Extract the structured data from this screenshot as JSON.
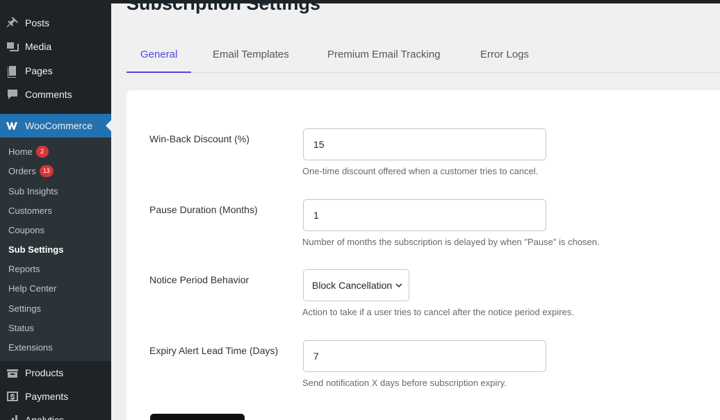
{
  "sidebar": {
    "top_items": [
      {
        "label": "Posts",
        "icon": "pin-icon"
      },
      {
        "label": "Media",
        "icon": "media-icon"
      },
      {
        "label": "Pages",
        "icon": "pages-icon"
      },
      {
        "label": "Comments",
        "icon": "comment-icon"
      }
    ],
    "woocommerce": {
      "label": "WooCommerce",
      "icon": "woo-icon"
    },
    "submenu": [
      {
        "label": "Home",
        "badge": "2"
      },
      {
        "label": "Orders",
        "badge": "13"
      },
      {
        "label": "Sub Insights"
      },
      {
        "label": "Customers"
      },
      {
        "label": "Coupons"
      },
      {
        "label": "Sub Settings",
        "active": true
      },
      {
        "label": "Reports"
      },
      {
        "label": "Help Center"
      },
      {
        "label": "Settings"
      },
      {
        "label": "Status"
      },
      {
        "label": "Extensions"
      }
    ],
    "bottom_items": [
      {
        "label": "Products",
        "icon": "products-icon"
      },
      {
        "label": "Payments",
        "icon": "payments-icon"
      },
      {
        "label": "Analytics",
        "icon": "analytics-icon"
      }
    ]
  },
  "page": {
    "title": "Subscription Settings"
  },
  "tabs": [
    {
      "label": "General",
      "active": true
    },
    {
      "label": "Email Templates"
    },
    {
      "label": "Premium Email Tracking"
    },
    {
      "label": "Error Logs"
    }
  ],
  "form": {
    "win_back": {
      "label": "Win-Back Discount (%)",
      "value": "15",
      "help": "One-time discount offered when a customer tries to cancel."
    },
    "pause": {
      "label": "Pause Duration (Months)",
      "value": "1",
      "help": "Number of months the subscription is delayed by when \"Pause\" is chosen."
    },
    "notice": {
      "label": "Notice Period Behavior",
      "value": "Block Cancellation",
      "help": "Action to take if a user tries to cancel after the notice period expires."
    },
    "expiry": {
      "label": "Expiry Alert Lead Time (Days)",
      "value": "7",
      "help": "Send notification X days before subscription expiry."
    }
  },
  "colors": {
    "accent": "#4f46e5",
    "woo_blue": "#2271b1",
    "sidebar": "#1d2327",
    "badge": "#d63638"
  }
}
